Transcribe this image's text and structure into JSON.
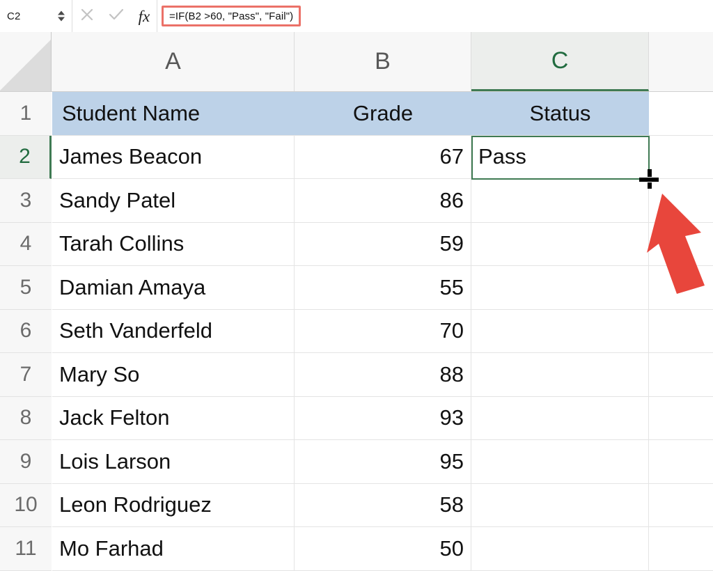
{
  "formula_bar": {
    "name_box_value": "C2",
    "cancel_icon": "cancel-x-icon",
    "confirm_icon": "confirm-check-icon",
    "fx_icon": "fx",
    "formula_value": "=IF(B2 >60, \"Pass\", \"Fail\")",
    "highlight_color": "#eb7168"
  },
  "sheet": {
    "columns": [
      {
        "letter": "A",
        "selected": false
      },
      {
        "letter": "B",
        "selected": false
      },
      {
        "letter": "C",
        "selected": true
      }
    ],
    "row_numbers": [
      "1",
      "2",
      "3",
      "4",
      "5",
      "6",
      "7",
      "8",
      "9",
      "10",
      "11"
    ],
    "selected_row": "2",
    "selected_cell": "C2",
    "header_fill": "#bdd2e8",
    "selection_color": "#3f7a53",
    "table_headers": [
      "Student Name",
      "Grade",
      "Status"
    ],
    "rows": [
      {
        "row": "2",
        "name": "James Beacon",
        "grade": "67",
        "status": "Pass"
      },
      {
        "row": "3",
        "name": "Sandy Patel",
        "grade": "86",
        "status": ""
      },
      {
        "row": "4",
        "name": "Tarah Collins",
        "grade": "59",
        "status": ""
      },
      {
        "row": "5",
        "name": "Damian Amaya",
        "grade": "55",
        "status": ""
      },
      {
        "row": "6",
        "name": "Seth Vanderfeld",
        "grade": "70",
        "status": ""
      },
      {
        "row": "7",
        "name": "Mary So",
        "grade": "88",
        "status": ""
      },
      {
        "row": "8",
        "name": "Jack Felton",
        "grade": "93",
        "status": ""
      },
      {
        "row": "9",
        "name": "Lois Larson",
        "grade": "95",
        "status": ""
      },
      {
        "row": "10",
        "name": "Leon Rodriguez",
        "grade": "58",
        "status": ""
      },
      {
        "row": "11",
        "name": "Mo Farhad",
        "grade": "50",
        "status": ""
      }
    ]
  },
  "annotations": {
    "arrow_color": "#e8463c",
    "arrow_name": "red-pointer-arrow",
    "cursor_name": "fill-handle-crosshair-cursor"
  }
}
